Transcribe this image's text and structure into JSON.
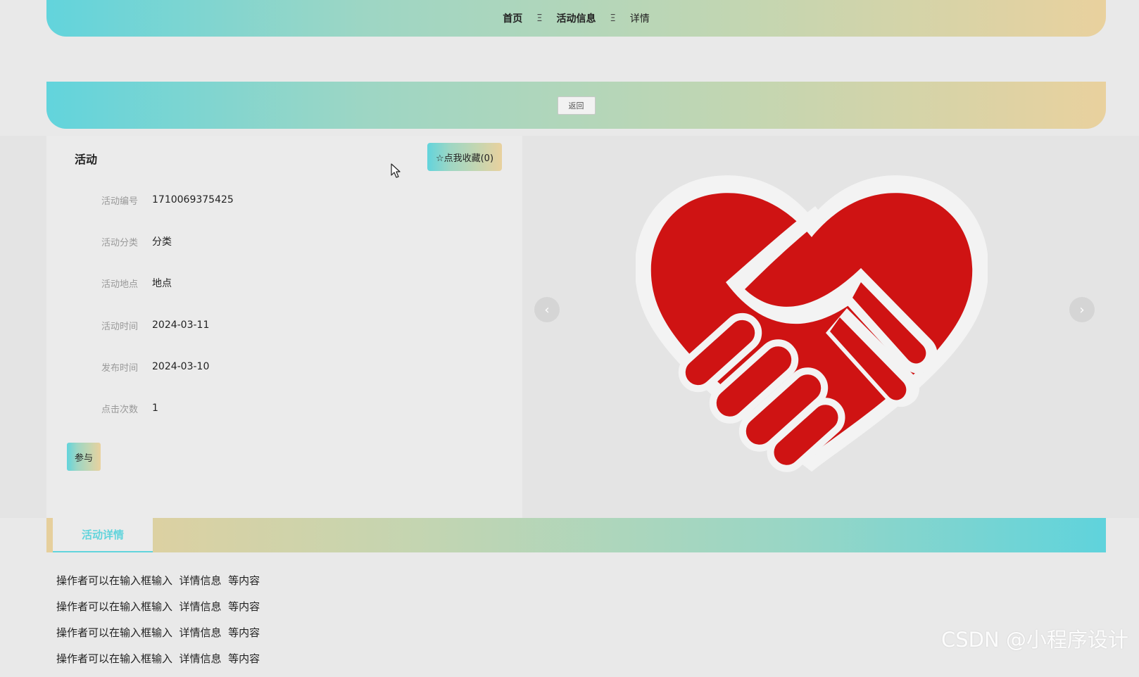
{
  "breadcrumb": {
    "items": [
      "首页",
      "活动信息",
      "详情"
    ],
    "separator": "Ξ"
  },
  "back_button": "返回",
  "activity": {
    "title": "活动",
    "favorite_button": "☆点我收藏(0)",
    "fields": [
      {
        "label": "活动编号",
        "value": "1710069375425"
      },
      {
        "label": "活动分类",
        "value": "分类"
      },
      {
        "label": "活动地点",
        "value": "地点"
      },
      {
        "label": "活动时间",
        "value": "2024-03-11"
      },
      {
        "label": "发布时间",
        "value": "2024-03-10"
      },
      {
        "label": "点击次数",
        "value": "1"
      }
    ],
    "join_button": "参与"
  },
  "carousel": {
    "prev_icon": "‹",
    "next_icon": "›",
    "image_icon": "heart-handshake-icon"
  },
  "detail_tab": "活动详情",
  "detail_lines": [
    "操作者可以在输入框输入  详情信息  等内容",
    "操作者可以在输入框输入  详情信息  等内容",
    "操作者可以在输入框输入  详情信息  等内容",
    "操作者可以在输入框输入  详情信息  等内容"
  ],
  "watermark": "CSDN @小程序设计",
  "colors": {
    "accent_cyan": "#62d4dc",
    "accent_sand": "#e9d19e",
    "heart_red": "#cf1313"
  }
}
